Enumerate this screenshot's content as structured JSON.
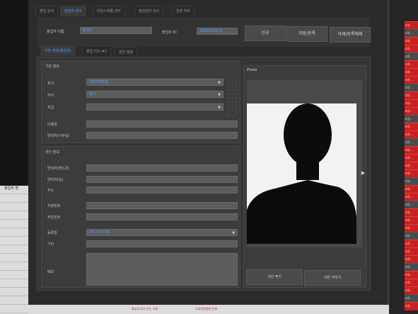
{
  "tabs": [
    "출입 검색",
    "출입자 관리",
    "타임스케쥴 관리",
    "출입권한 관리",
    "일괄 처리"
  ],
  "header": {
    "name_label": "출입자 이름",
    "name_value": "출입자",
    "id_label": "출입자 ID",
    "id_value": "2200226413",
    "new_button": "신규",
    "save_button": "저장/등록",
    "delete_button": "삭제/등록해제"
  },
  "subtabs": [
    "기본 정보(출입자)",
    "출입 카드 #1",
    "권한 설정"
  ],
  "basic_info": {
    "title": "기본 정보",
    "company_label": "회사",
    "company_value": "고양지방법원",
    "department_label": "부서",
    "department_value": "정사",
    "position_label": "직급",
    "position_value": "",
    "email_label": "이메일",
    "phone_label": "연락처(사무실)"
  },
  "personal_info": {
    "title": "개인 정보",
    "mobile_label": "연락처(핸드폰)",
    "home_label": "연락처(집)",
    "address_label": "주소",
    "car_label": "차량번호",
    "resident_label": "주민번호",
    "reg_date_label": "등록일",
    "reg_date_value": "2013-03-05",
    "etc_label": "기타",
    "memo_label": "메모"
  },
  "photo": {
    "title": "Photo",
    "capture_button": "사진 찍기",
    "delete_button": "사진 지우기"
  },
  "left_panel_label": "출입자 명",
  "status_bar": [
    "출입자 추가 또는 삭제",
    "고양지방법원 인쇄"
  ],
  "right_list": [
    "고양...",
    "고양...",
    "고양...",
    "고양...",
    "고양...",
    "고양...",
    "고양...",
    "고양...",
    "고양...",
    "고양...",
    "고양...",
    "고양...",
    "고양...",
    "고양...",
    "고양...",
    "고양...",
    "고양...",
    "고양...",
    "고양...",
    "고양...",
    "고양...",
    "고양...",
    "고양...",
    "고양...",
    "고양...",
    "고양...",
    "고양...",
    "고양...",
    "고양...",
    "고양...",
    "고양...",
    "고양...",
    "고양...",
    "고양...",
    "고양...",
    "고양...",
    "고양..."
  ]
}
